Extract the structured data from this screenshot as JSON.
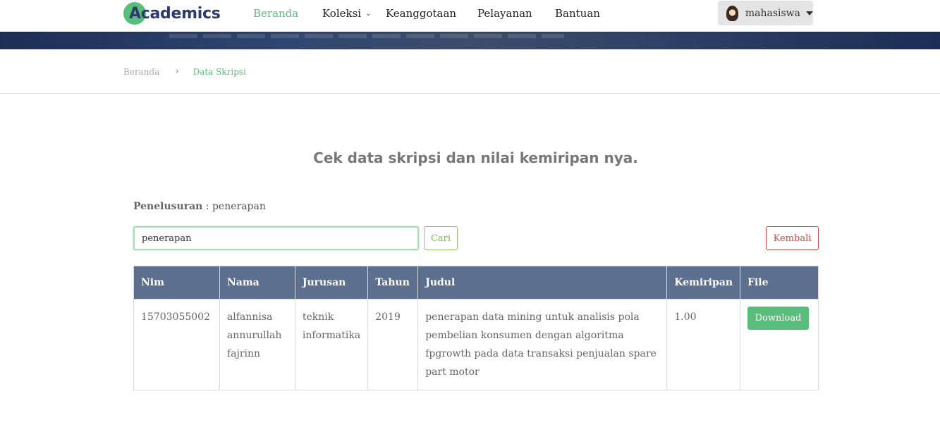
{
  "brand": {
    "logo_text": "Academics"
  },
  "nav": {
    "items": [
      {
        "label": "Beranda",
        "active": true
      },
      {
        "label": "Koleksi",
        "has_dropdown": true
      },
      {
        "label": "Keanggotaan"
      },
      {
        "label": "Pelayanan"
      },
      {
        "label": "Bantuan"
      }
    ],
    "user": {
      "name": "mahasiswa",
      "icon": "avatar"
    }
  },
  "breadcrumb": {
    "home": "Beranda",
    "current": "Data Skripsi"
  },
  "heading": "Cek data skripsi dan nilai kemiripan nya.",
  "search": {
    "label": "Penelusuran",
    "label_value": ": penerapan",
    "input_value": "penerapan",
    "search_button": "Cari",
    "back_button": "Kembali"
  },
  "table": {
    "columns": [
      "Nim",
      "Nama",
      "Jurusan",
      "Tahun",
      "Judul",
      "Kemiripan",
      "File"
    ],
    "rows": [
      {
        "nim": "15703055002",
        "nama": "alfannisa annurullah fajrinn",
        "jurusan": "teknik informatika",
        "tahun": "2019",
        "judul": "penerapan data mining untuk analisis pola pembelian konsumen dengan algoritma fpgrowth pada data transaksi penjualan spare part motor",
        "kemiripan": "1.00",
        "file_button": "Download"
      }
    ]
  },
  "colors": {
    "accent_green": "#59bd7b",
    "table_header": "#5d6f8f",
    "danger": "#d34a45",
    "brand_navy": "#2d3b6b"
  }
}
